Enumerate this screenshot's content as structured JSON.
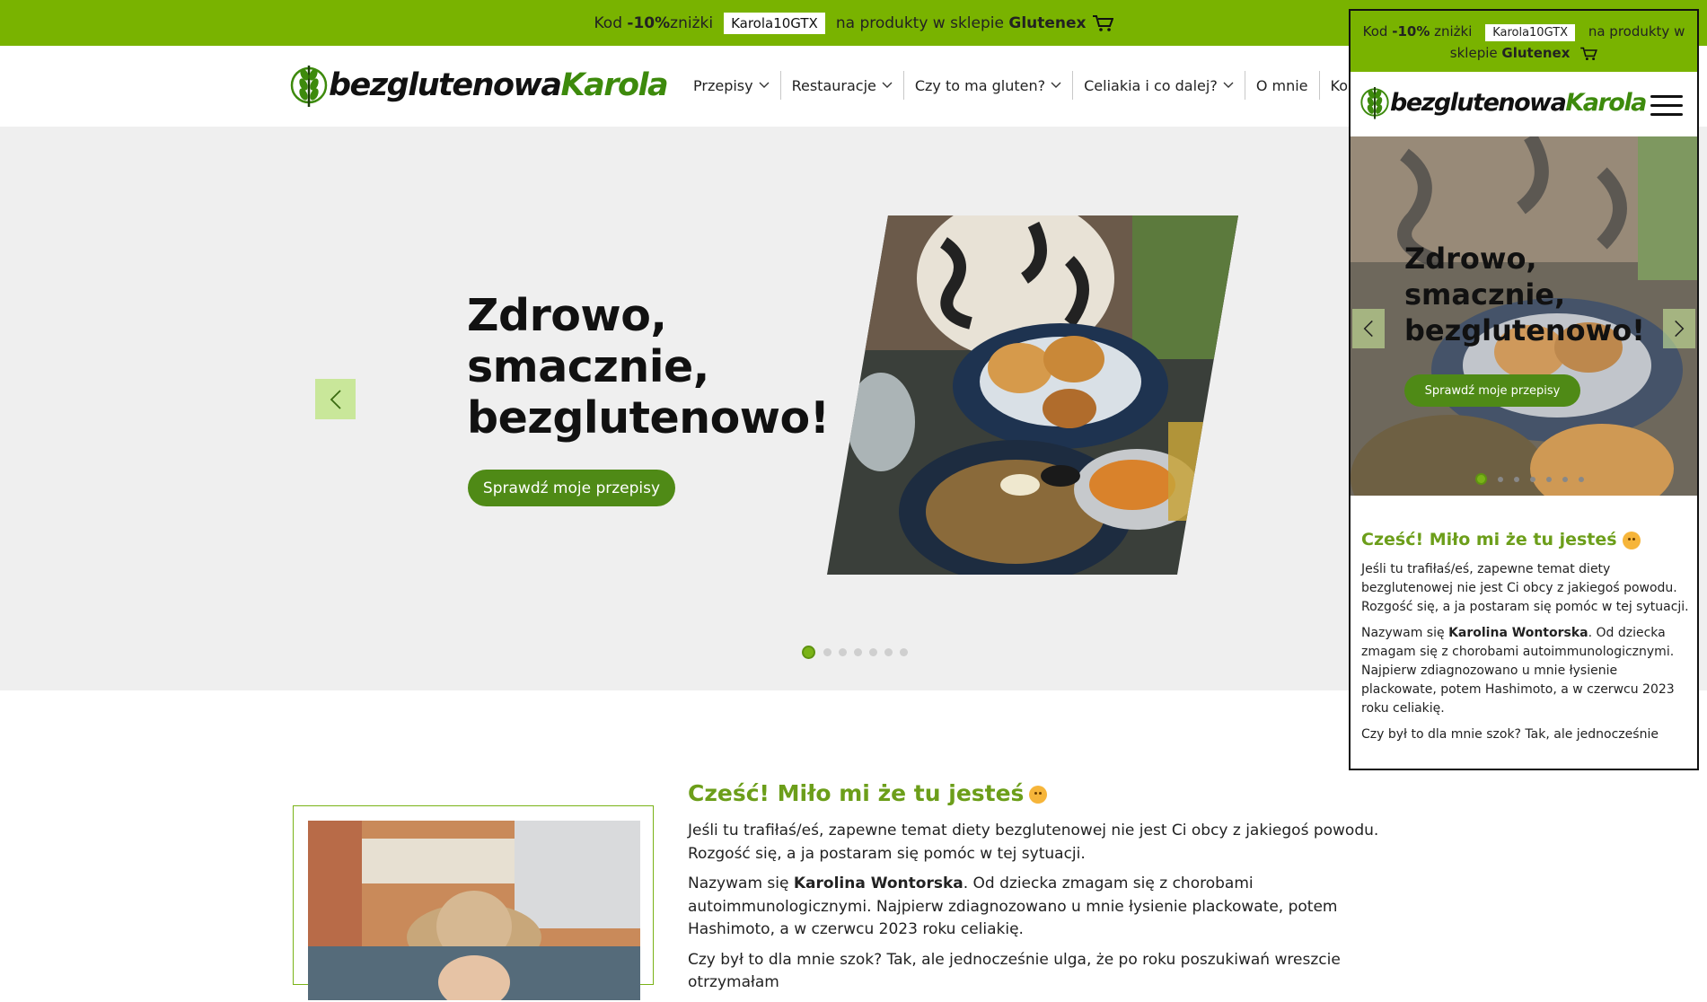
{
  "promo": {
    "prefix": "Kod ",
    "discount": "-10%",
    "middle": " zniżki",
    "code": "Karola10GTX",
    "suffix": "na produkty w sklepie ",
    "store": "Glutenex"
  },
  "logo": {
    "part1": "bezglutenowa",
    "part2": "Karola"
  },
  "nav": [
    "Przepisy",
    "Restauracje",
    "Czy to ma gluten?",
    "Celiakia i co dalej?",
    "O mnie",
    "Kontakt"
  ],
  "hero": {
    "title_line1": "Zdrowo,",
    "title_line2": "smacznie,",
    "title_line3": "bezglutenowo!",
    "cta": "Sprawdź moje przepisy",
    "slide_count": 7,
    "active_slide": 1
  },
  "greeting": {
    "title": "Cześć! Miło mi że tu jesteś",
    "p1": "Jeśli tu trafiłaś/eś, zapewne temat diety bezglutenowej nie jest Ci obcy z jakiegoś powodu. Rozgość się, a ja postaram się pomóc w tej sytuacji.",
    "p2_prefix": "Nazywam się ",
    "p2_name": "Karolina Wontorska",
    "p2_suffix": ". Od dziecka zmagam się z chorobami autoimmunologicznymi. Najpierw zdiagnozowano u mnie łysienie plackowate, potem Hashimoto, a w czerwcu 2023 roku celiakię.",
    "p3": "Czy był to dla mnie szok? Tak, ale jednocześnie ulga, że po roku poszukiwań wreszcie otrzymałam",
    "p3_mobile": "Czy był to dla mnie szok? Tak, ale jednocześnie"
  },
  "colors": {
    "accent": "#79b300",
    "brand_green": "#4f8a16",
    "title_green": "#6c9e1a"
  }
}
